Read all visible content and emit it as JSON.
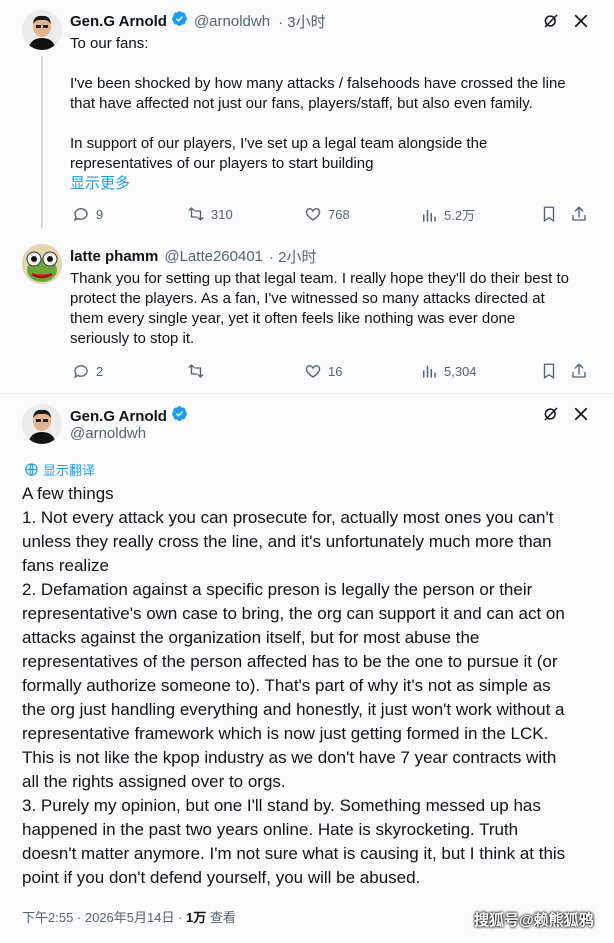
{
  "tweet1": {
    "name": "Gen.G Arnold",
    "handle": "@arnoldwh",
    "time": "· 3小时",
    "body": "To our fans:\n\nI've been shocked by how many attacks / falsehoods have crossed the line\nthat have affected not just our fans, players/staff, but also even family.\n\nIn support of our players, I've set up a legal team alongside the\nrepresentatives of our players to start building",
    "show_more": "显示更多",
    "replies": "9",
    "retweets": "310",
    "likes": "768",
    "views": "5.2万"
  },
  "tweet2": {
    "name": "latte phamm",
    "handle": "@Latte260401",
    "time": "· 2小时",
    "body": "Thank you for setting up that legal team. I really hope they'll do their best to\nprotect the players. As a fan, I've witnessed so many attacks directed at\nthem every single year, yet it often feels like nothing was ever done\nseriously to stop it.",
    "replies": "2",
    "retweets": "",
    "likes": "16",
    "views": "5,304"
  },
  "tweet3": {
    "name": "Gen.G Arnold",
    "handle": "@arnoldwh",
    "translate": "显示翻译",
    "body": "A few things\n1. Not every attack you can prosecute for, actually most ones you can't\nunless they really cross the line, and it's unfortunately much more than\nfans realize\n2. Defamation against a specific preson is legally the person or their\nrepresentative's own case to bring, the org can support it and can act on\nattacks against the organization itself, but for most abuse the\nrepresentatives of the person affected has to be the one to pursue it (or\nformally authorize someone to). That's part of why it's not as simple as\nthe org just handling everything and honestly, it just won't work without a\nrepresentative framework which is now just getting formed in the LCK.\nThis is not like the kpop industry as we don't have 7 year contracts with\nall the rights assigned over to orgs.\n3. Purely my opinion, but one I'll stand by. Something messed up has\nhappened in the past two years online. Hate is skyrocketing. Truth\ndoesn't matter anymore. I'm not sure what is causing it, but I think at this\npoint if you don't defend yourself, you will be abused.",
    "footer_time": "下午2:55 · 2026年5月14日 · ",
    "footer_views": "1万",
    "footer_views_label": " 查看"
  },
  "watermark": "搜狐号@赖熊狐鸦",
  "colors": {
    "verified": "#1d9bf0",
    "link": "#1d9bf0",
    "muted": "#536471"
  }
}
